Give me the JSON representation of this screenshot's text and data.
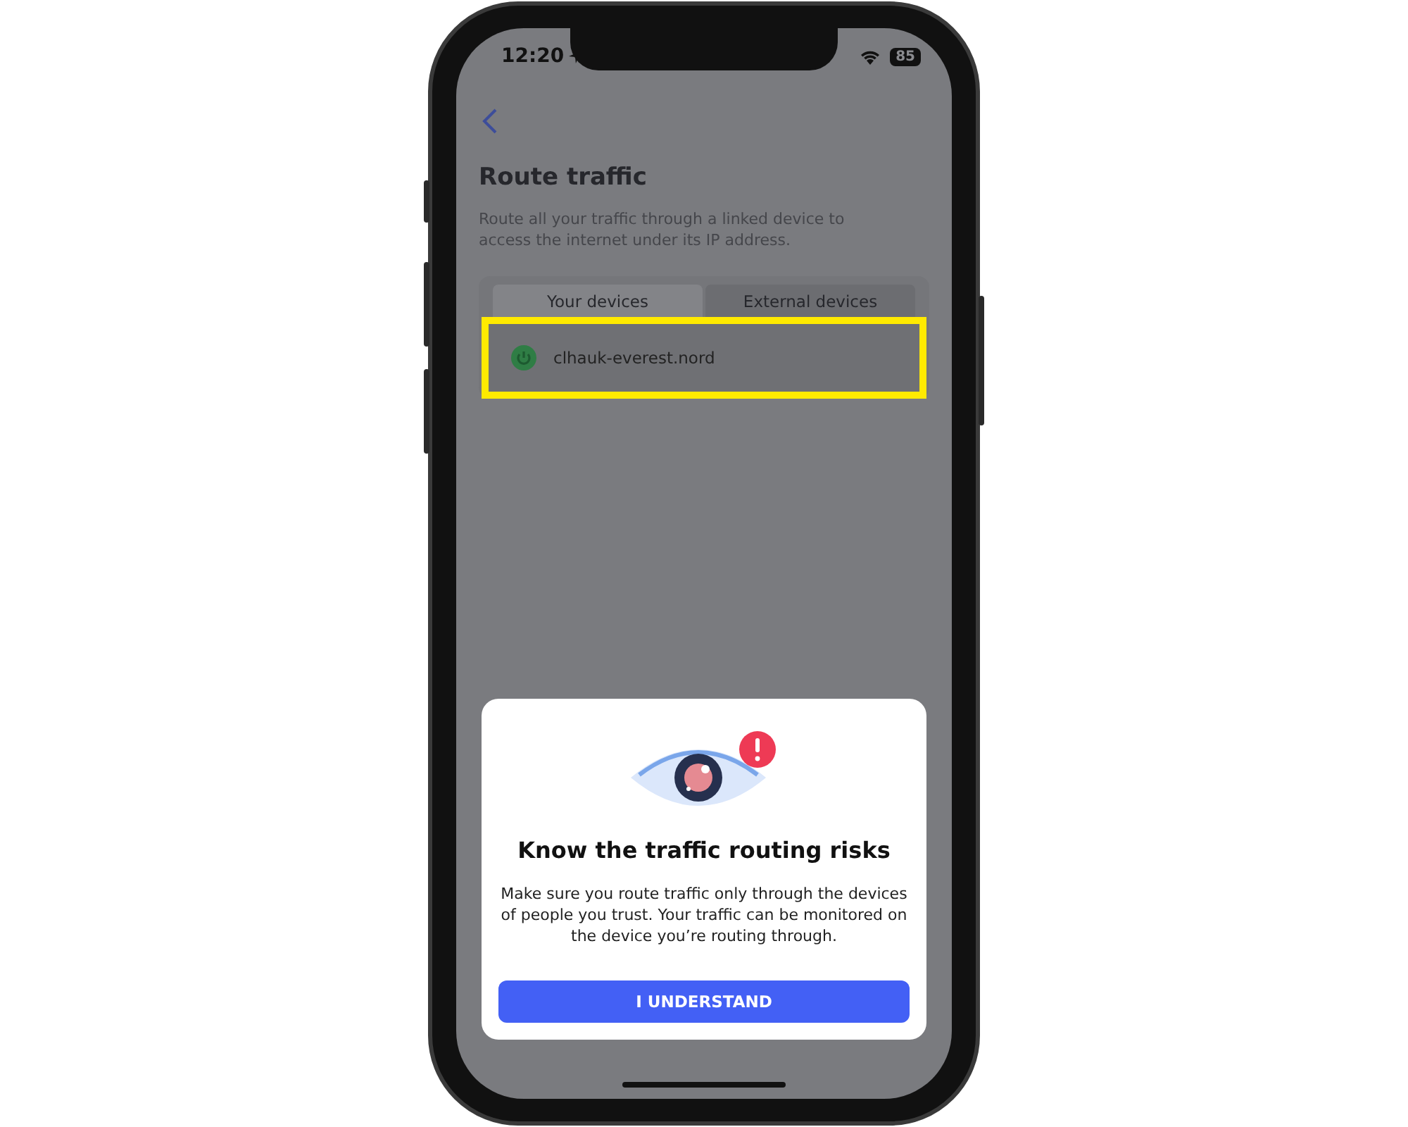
{
  "status_bar": {
    "time": "12:20",
    "battery": "85"
  },
  "header": {
    "title": "Route traffic",
    "description": "Route all your traffic through a linked device to access the internet under its IP address."
  },
  "tabs": [
    {
      "label": "Your devices",
      "selected": true
    },
    {
      "label": "External devices",
      "selected": false
    }
  ],
  "devices": [
    {
      "name": "clhauk-everest.nord",
      "highlighted": true
    }
  ],
  "dialog": {
    "title": "Know the traffic routing risks",
    "message": "Make sure you route traffic only through the devices of people you trust. Your traffic can be monitored on the device you’re routing through.",
    "button": "I UNDERSTAND"
  }
}
